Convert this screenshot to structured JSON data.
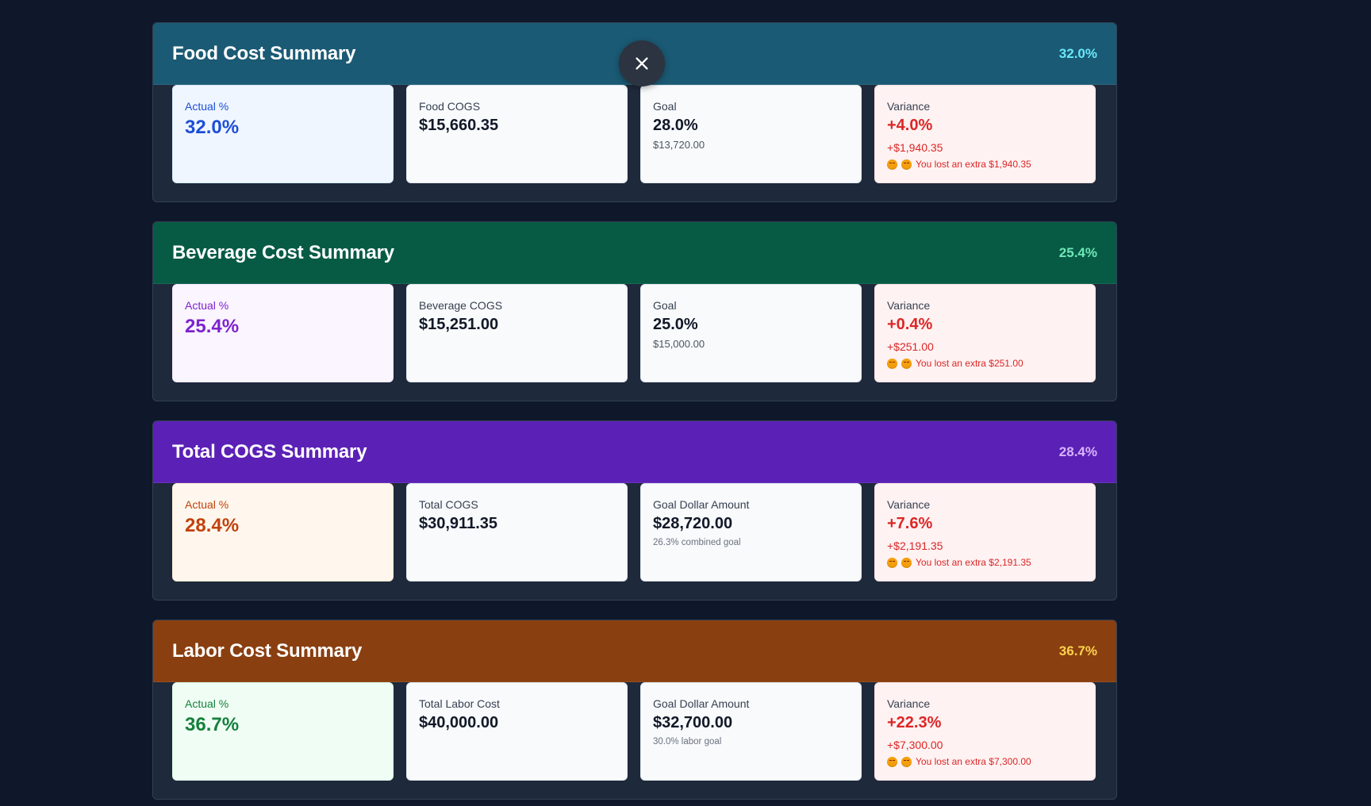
{
  "close_icon": "close-icon",
  "sections": [
    {
      "title": "Food Cost Summary",
      "header_pct": "32.0%",
      "header_color": "#1b5a74",
      "pct_color": "#67e8f9",
      "actual": {
        "label": "Actual %",
        "value": "32.0%",
        "bg": "#eff6ff",
        "border": "#dbeafe",
        "color": "#1d4ed8"
      },
      "cogs": {
        "label": "Food COGS",
        "value": "$15,660.35"
      },
      "goal": {
        "label": "Goal",
        "value": "28.0%",
        "sub": "$13,720.00"
      },
      "variance": {
        "label": "Variance",
        "value": "+4.0%",
        "amount": "+$1,940.35",
        "note": "You lost an extra $1,940.35"
      }
    },
    {
      "title": "Beverage Cost Summary",
      "header_pct": "25.4%",
      "header_color": "#075b45",
      "pct_color": "#6ee7b7",
      "actual": {
        "label": "Actual %",
        "value": "25.4%",
        "bg": "#faf5ff",
        "border": "#f3e8ff",
        "color": "#7e22ce"
      },
      "cogs": {
        "label": "Beverage COGS",
        "value": "$15,251.00"
      },
      "goal": {
        "label": "Goal",
        "value": "25.0%",
        "sub": "$15,000.00"
      },
      "variance": {
        "label": "Variance",
        "value": "+0.4%",
        "amount": "+$251.00",
        "note": "You lost an extra $251.00"
      }
    },
    {
      "title": "Total COGS Summary",
      "header_pct": "28.4%",
      "header_color": "#5b21b6",
      "pct_color": "#d8b4fe",
      "actual": {
        "label": "Actual %",
        "value": "28.4%",
        "bg": "#fff7ed",
        "border": "#ffedd5",
        "color": "#c2410c"
      },
      "cogs": {
        "label": "Total COGS",
        "value": "$30,911.35"
      },
      "goal": {
        "label": "Goal Dollar Amount",
        "value": "$28,720.00",
        "sub_small": "26.3% combined goal"
      },
      "variance": {
        "label": "Variance",
        "value": "+7.6%",
        "amount": "+$2,191.35",
        "note": "You lost an extra $2,191.35"
      }
    },
    {
      "title": "Labor Cost Summary",
      "header_pct": "36.7%",
      "header_color": "#8a3f10",
      "pct_color": "#fcd34d",
      "actual": {
        "label": "Actual %",
        "value": "36.7%",
        "bg": "#f0fdf4",
        "border": "#dcfce7",
        "color": "#15803d"
      },
      "cogs": {
        "label": "Total Labor Cost",
        "value": "$40,000.00"
      },
      "goal": {
        "label": "Goal Dollar Amount",
        "value": "$32,700.00",
        "sub_small": "30.0% labor goal"
      },
      "variance": {
        "label": "Variance",
        "value": "+22.3%",
        "amount": "+$7,300.00",
        "note": "You lost an extra $7,300.00"
      }
    }
  ]
}
